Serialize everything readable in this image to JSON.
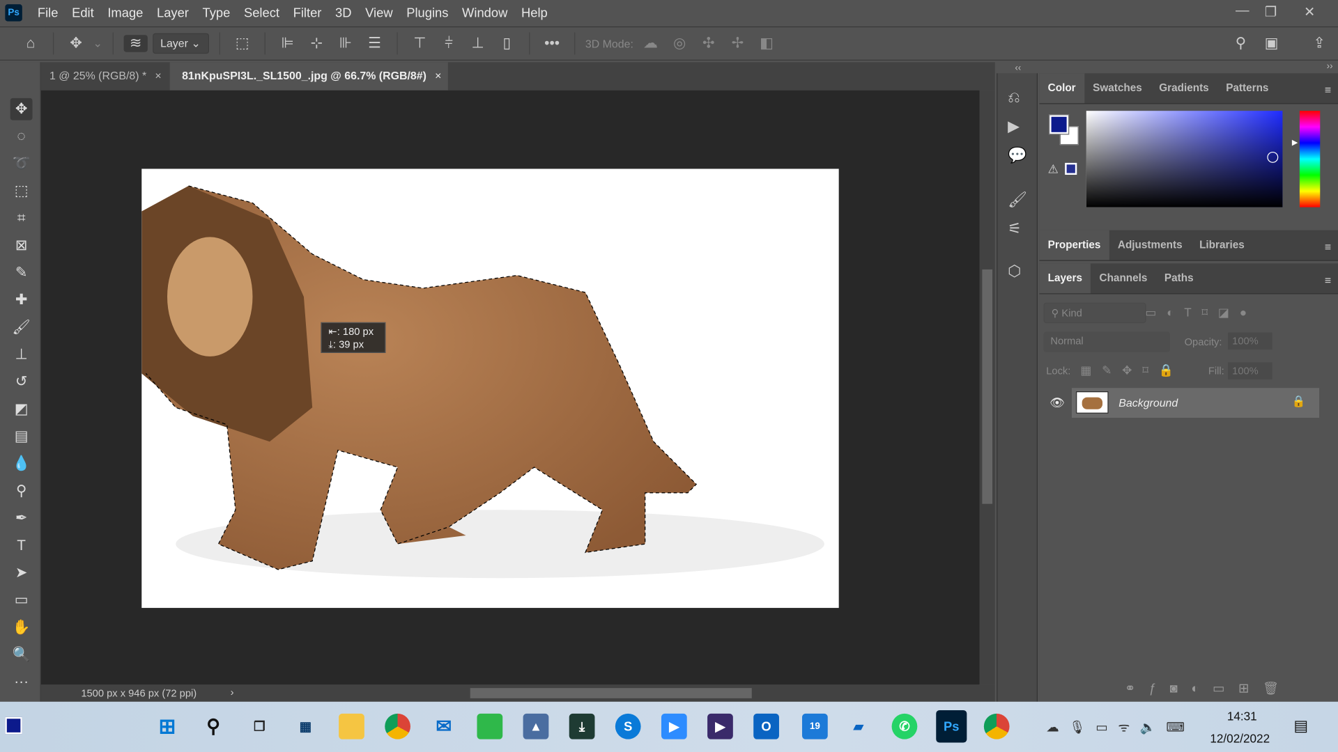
{
  "app": {
    "logo": "Ps",
    "menu": [
      "File",
      "Edit",
      "Image",
      "Layer",
      "Type",
      "Select",
      "Filter",
      "3D",
      "View",
      "Plugins",
      "Window",
      "Help"
    ]
  },
  "options": {
    "layer_dropdown": "Layer",
    "mode_label": "3D Mode:"
  },
  "tabs": [
    {
      "label": "1 @ 25% (RGB/8) *",
      "close": "×"
    },
    {
      "label": "81nKpuSPI3L._SL1500_.jpg @ 66.7% (RGB/8#)",
      "close": "×"
    }
  ],
  "tooltip": {
    "dx": "180 px",
    "dy": "39 px"
  },
  "status": {
    "doc_info": "1500 px x 946 px (72 ppi)"
  },
  "color_panel": {
    "tabs": [
      "Color",
      "Swatches",
      "Gradients",
      "Patterns"
    ],
    "foreground": "#0c1a8c",
    "background": "#ffffff",
    "hue_color": "#1f2cff"
  },
  "properties_panel": {
    "tabs": [
      "Properties",
      "Adjustments",
      "Libraries"
    ]
  },
  "layers_panel": {
    "tabs": [
      "Layers",
      "Channels",
      "Paths"
    ],
    "kind_placeholder": "Kind",
    "blend_mode": "Normal",
    "opacity_label": "Opacity:",
    "opacity": "100%",
    "lock_label": "Lock:",
    "fill_label": "Fill:",
    "fill": "100%",
    "layers": [
      {
        "name": "Background",
        "visible": true,
        "locked": true
      }
    ]
  },
  "taskbar": {
    "time": "14:31",
    "date": "12/02/2022",
    "mail_badge": "19"
  }
}
